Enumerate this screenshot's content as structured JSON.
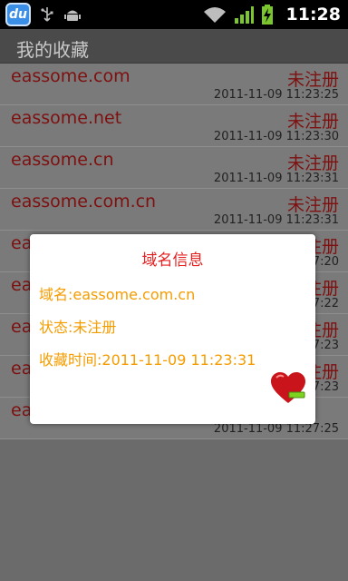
{
  "status_bar": {
    "app_icon_label": "du",
    "time": "11:28"
  },
  "title": "我的收藏",
  "list": [
    {
      "domain": "eassome.com",
      "status": "未注册",
      "time": "2011-11-09 11:23:25"
    },
    {
      "domain": "eassome.net",
      "status": "未注册",
      "time": "2011-11-09 11:23:30"
    },
    {
      "domain": "eassome.cn",
      "status": "未注册",
      "time": "2011-11-09 11:23:31"
    },
    {
      "domain": "eassome.com.cn",
      "status": "未注册",
      "time": "2011-11-09 11:23:31"
    },
    {
      "domain": "eaion.hk",
      "status": "未注册",
      "time": "2011-11-09 11:27:20"
    },
    {
      "domain": "ea...",
      "status": "未注册",
      "time": "2011-11-09 11:27:22"
    },
    {
      "domain": "ea...",
      "status": "已注册",
      "time": "2011-11-09 11:27:23"
    },
    {
      "domain": "eaion.cn",
      "status": "已注册",
      "time": "2011-11-09 11:27:23"
    },
    {
      "domain": "eaion.name",
      "status": "",
      "time": "2011-11-09 11:27:25"
    }
  ],
  "dialog": {
    "title": "域名信息",
    "domain_line": "域名:eassome.com.cn",
    "status_line": "状态:未注册",
    "time_line": "收藏时间:2011-11-09 11:23:31"
  },
  "colors": {
    "domain_text": "#7e1010",
    "dialog_title": "#e41f1f",
    "dialog_text": "#f59c00"
  }
}
